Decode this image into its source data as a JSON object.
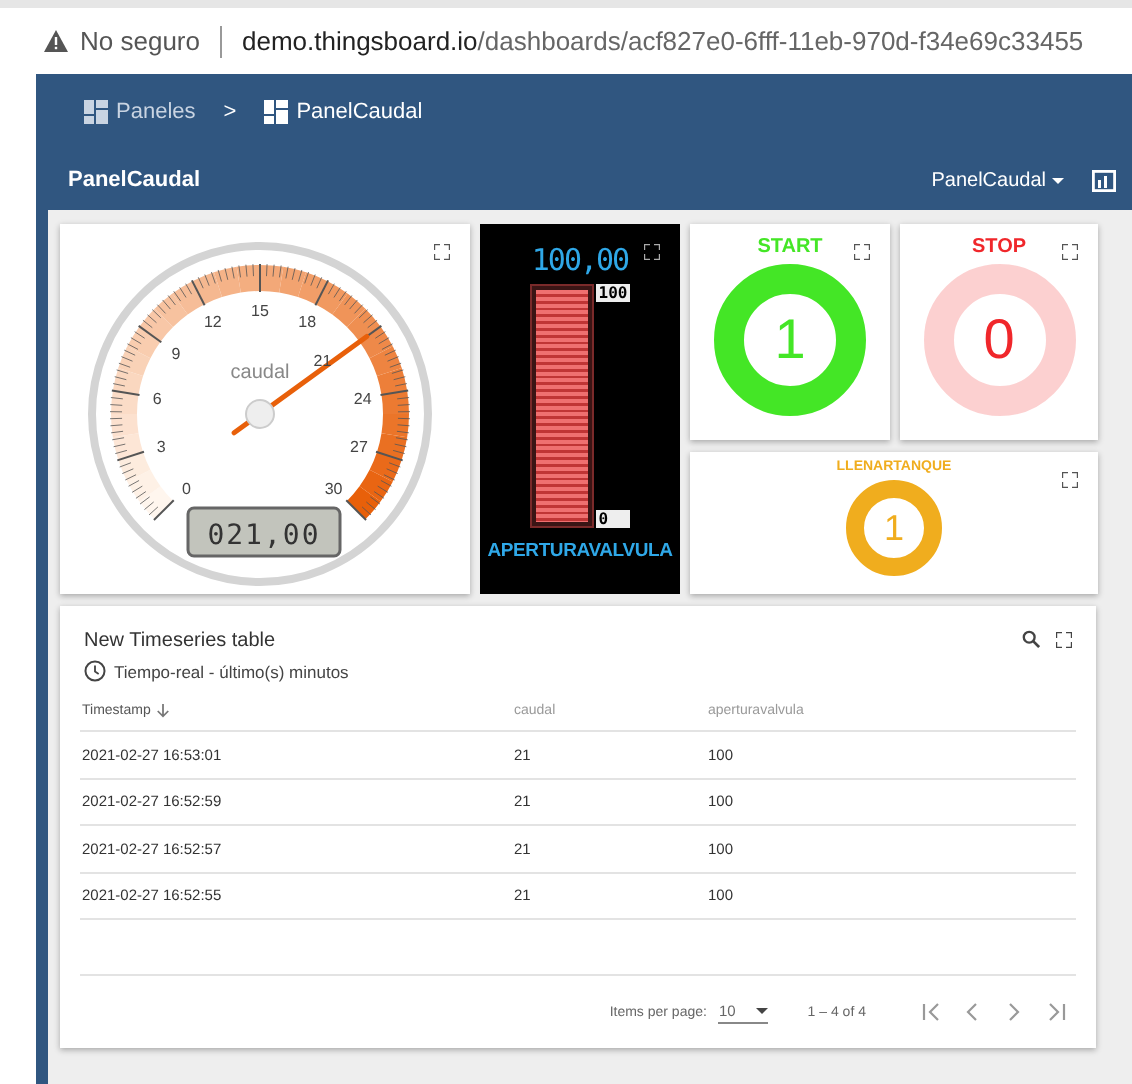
{
  "browser": {
    "security": "No seguro",
    "url_host": "demo.thingsboard.io",
    "url_path": "/dashboards/acf827e0-6fff-11eb-970d-f34e69c33455"
  },
  "breadcrumbs": [
    {
      "label": "Paneles",
      "selected": false
    },
    {
      "label": "PanelCaudal",
      "selected": true
    }
  ],
  "breadcrumb_separator": ">",
  "toolbar": {
    "title": "PanelCaudal",
    "dashboard_select": "PanelCaudal"
  },
  "gauge": {
    "label": "caudal",
    "ticks": [
      "0",
      "3",
      "6",
      "9",
      "12",
      "15",
      "18",
      "21",
      "24",
      "27",
      "30"
    ],
    "display": "021,00"
  },
  "bar_gauge": {
    "value": "100,00",
    "max": "100",
    "min": "0",
    "level": 1.0,
    "label": "APERTURAVALVULA"
  },
  "indicators": [
    {
      "title": "START",
      "value": "1",
      "color": "#44e626",
      "active": true
    },
    {
      "title": "STOP",
      "value": "0",
      "color": "#f0272b",
      "active": false
    },
    {
      "title": "LLENARTANQUE",
      "value": "1",
      "color": "#f0ad1e",
      "active": true
    }
  ],
  "table": {
    "title": "New Timeseries table",
    "timewindow": "Tiempo-real - último(s) minutos",
    "columns": [
      {
        "label": "Timestamp",
        "sorted": true
      },
      {
        "label": "caudal",
        "sorted": false
      },
      {
        "label": "aperturavalvula",
        "sorted": false
      }
    ],
    "rows": [
      [
        "2021-02-27 16:53:01",
        "21",
        "100"
      ],
      [
        "2021-02-27 16:52:59",
        "21",
        "100"
      ],
      [
        "2021-02-27 16:52:57",
        "21",
        "100"
      ],
      [
        "2021-02-27 16:52:55",
        "21",
        "100"
      ]
    ],
    "pagination": {
      "items_per_page_label": "Items per page:",
      "page_size": "10",
      "range": "1 – 4 of 4"
    }
  }
}
